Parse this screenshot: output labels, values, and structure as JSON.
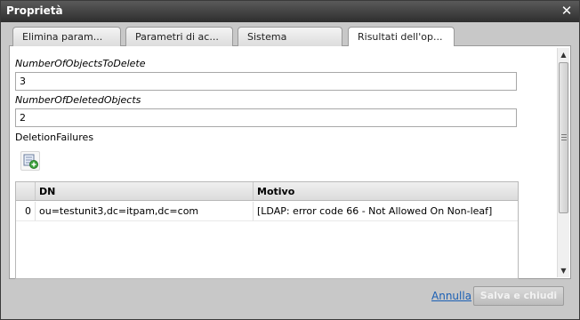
{
  "window": {
    "title": "Proprietà",
    "close_glyph": "✕"
  },
  "tabs": [
    {
      "label": "Elimina param...",
      "active": false
    },
    {
      "label": "Parametri di ac...",
      "active": false
    },
    {
      "label": "Sistema",
      "active": false
    },
    {
      "label": "Risultati dell'op...",
      "active": true
    }
  ],
  "fields": {
    "objects_to_delete": {
      "label": "NumberOfObjectsToDelete",
      "value": "3"
    },
    "deleted_objects": {
      "label": "NumberOfDeletedObjects",
      "value": "2"
    },
    "failures_label": "DeletionFailures"
  },
  "grid": {
    "columns": [
      "DN",
      "Motivo"
    ],
    "rows": [
      {
        "index": "0",
        "dn": "ou=testunit3,dc=itpam,dc=com",
        "motivo": "[LDAP: error code 66 - Not Allowed On Non-leaf]"
      }
    ]
  },
  "footer": {
    "cancel_label": "Annulla",
    "save_label": "Salva e chiudi"
  },
  "icons": {
    "add_row": "add-row-icon",
    "close": "close-icon"
  }
}
